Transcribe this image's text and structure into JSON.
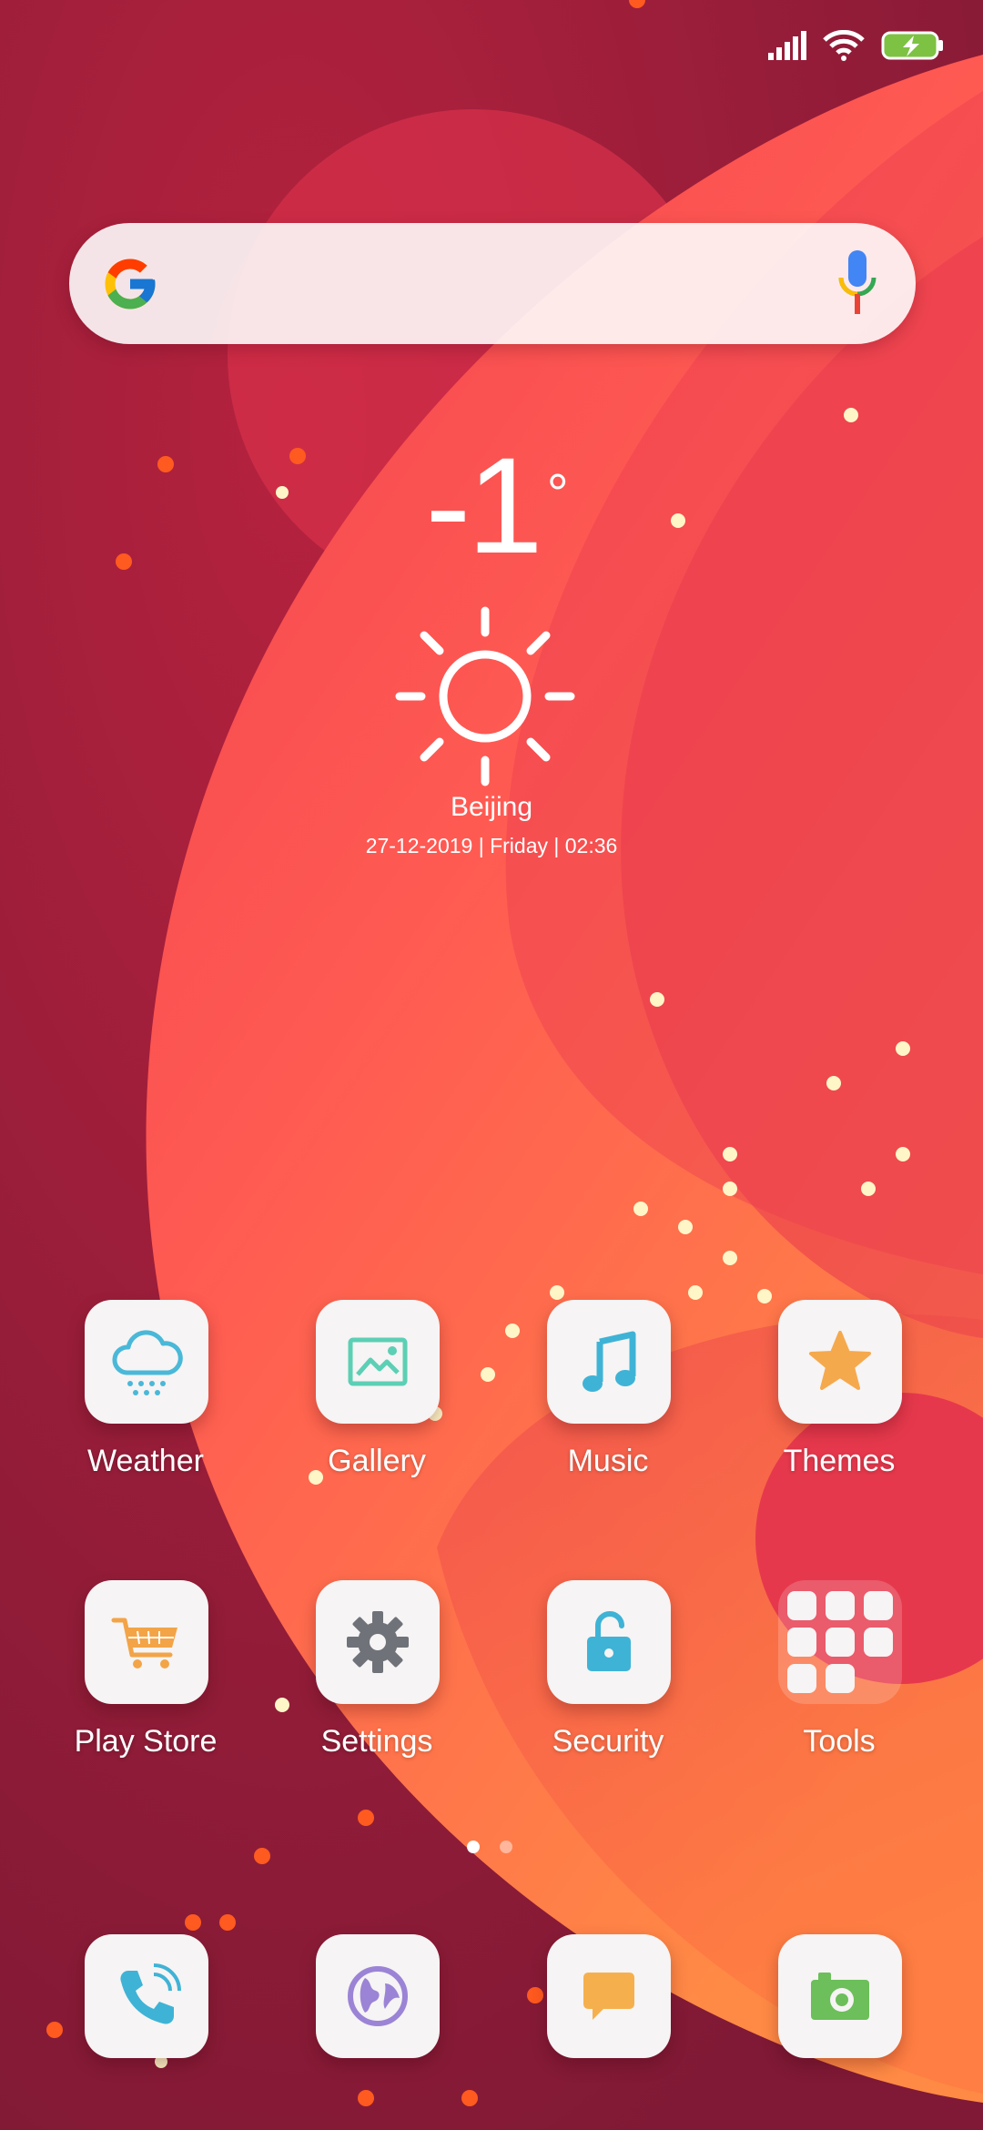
{
  "status_bar": {
    "icons": [
      "signal-icon",
      "wifi-icon",
      "battery-charging-icon"
    ]
  },
  "search": {
    "logo": "google-logo",
    "mic_icon": "microphone-icon"
  },
  "weather_widget": {
    "temperature": "-1",
    "degree_symbol": "°",
    "condition_icon": "sun-icon",
    "city": "Beijing",
    "datetime": "27-12-2019 | Friday | 02:36"
  },
  "apps_row1": [
    {
      "label": "Weather",
      "icon": "weather-cloud-icon"
    },
    {
      "label": "Gallery",
      "icon": "gallery-image-icon"
    },
    {
      "label": "Music",
      "icon": "music-note-icon"
    },
    {
      "label": "Themes",
      "icon": "star-icon"
    }
  ],
  "apps_row2": [
    {
      "label": "Play Store",
      "icon": "shopping-cart-icon"
    },
    {
      "label": "Settings",
      "icon": "gear-icon"
    },
    {
      "label": "Security",
      "icon": "lock-icon"
    },
    {
      "label": "Tools",
      "icon": "folder-icon"
    }
  ],
  "page_indicator": {
    "pages": 2,
    "active": 1
  },
  "dock": [
    {
      "icon": "phone-icon"
    },
    {
      "icon": "browser-globe-icon"
    },
    {
      "icon": "messages-icon"
    },
    {
      "icon": "camera-icon"
    }
  ],
  "colors": {
    "wallpaper_dark": "#8a1c38",
    "wallpaper_red": "#e8394f",
    "wallpaper_orange": "#ff7a45",
    "icon_tile": "#f6f4f4"
  }
}
